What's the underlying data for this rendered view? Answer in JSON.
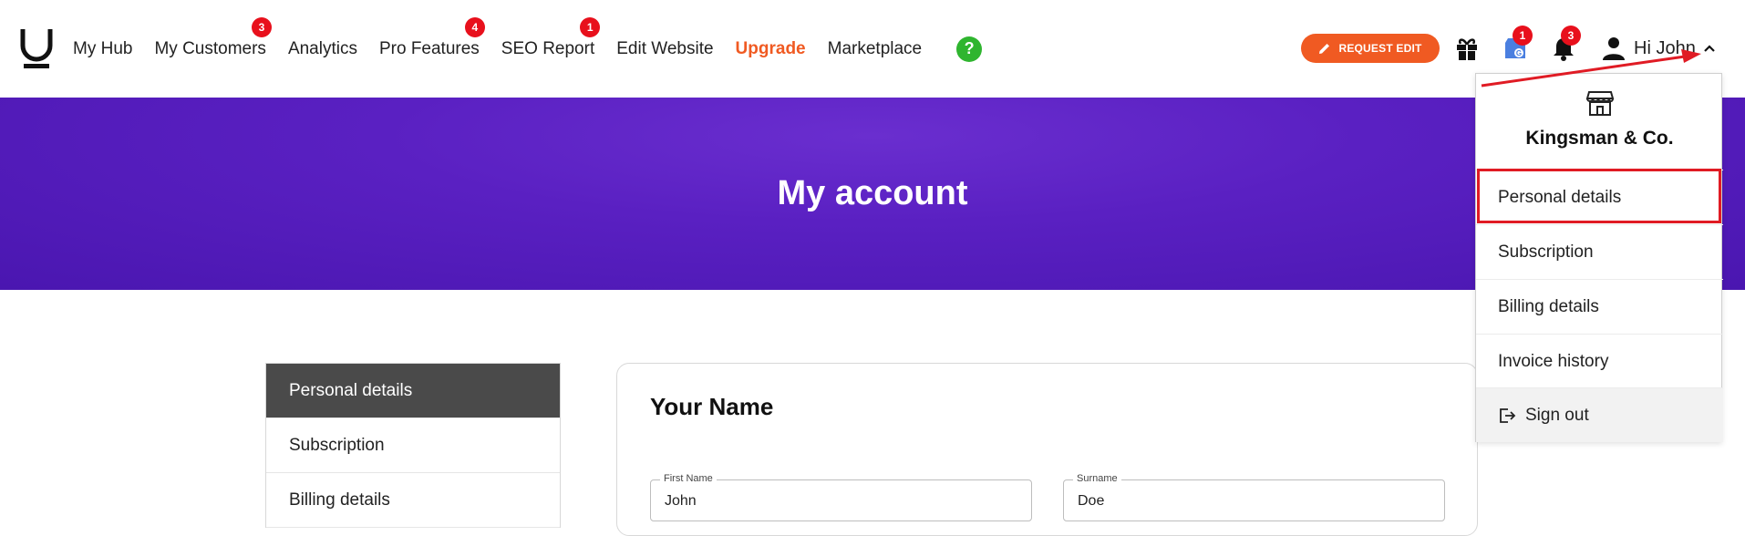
{
  "nav": {
    "items": [
      {
        "label": "My Hub",
        "badge": ""
      },
      {
        "label": "My Customers",
        "badge": "3"
      },
      {
        "label": "Analytics",
        "badge": ""
      },
      {
        "label": "Pro Features",
        "badge": "4"
      },
      {
        "label": "SEO Report",
        "badge": "1"
      },
      {
        "label": "Edit Website",
        "badge": ""
      },
      {
        "label": "Upgrade",
        "badge": ""
      },
      {
        "label": "Marketplace",
        "badge": ""
      }
    ],
    "help_label": "?"
  },
  "header": {
    "request_edit_label": "REQUEST EDIT",
    "google_badge": "1",
    "bell_badge": "3",
    "greeting": "Hi John",
    "accent_color": "#f05a22"
  },
  "hero": {
    "title": "My account"
  },
  "sidebar": {
    "items": [
      {
        "label": "Personal details",
        "active": true
      },
      {
        "label": "Subscription",
        "active": false
      },
      {
        "label": "Billing details",
        "active": false
      }
    ]
  },
  "card": {
    "title": "Your Name",
    "first_name_label": "First Name",
    "first_name_value": "John",
    "surname_label": "Surname",
    "surname_value": "Doe"
  },
  "dropdown": {
    "company": "Kingsman & Co.",
    "items": [
      "Personal details",
      "Subscription",
      "Billing details",
      "Invoice history"
    ],
    "sign_out": "Sign out"
  }
}
